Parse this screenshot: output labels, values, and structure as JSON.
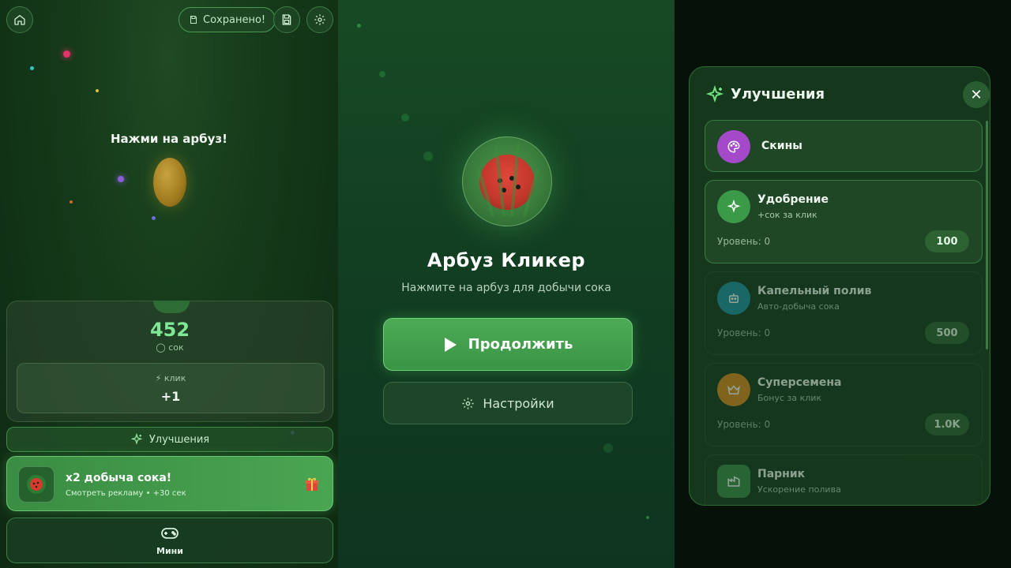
{
  "left_panel": {
    "saved_label": "Сохранено!",
    "tap_hint": "Нажми на арбуз!",
    "juice": {
      "value": "452",
      "unit": "сок"
    },
    "click": {
      "label": "клик",
      "value": "+1"
    },
    "upgrades_label": "Улучшения",
    "ad": {
      "title": "x2 добыча сока!",
      "subtitle": "Смотреть рекламу • +30 сек"
    },
    "mini_label": "Мини"
  },
  "main_menu": {
    "title": "Арбуз Кликер",
    "subtitle": "Нажмите на арбуз для добычи сока",
    "continue_label": "Продолжить",
    "settings_label": "Настройки"
  },
  "upgrades_modal": {
    "title": "Улучшения",
    "items": [
      {
        "name": "Скины",
        "icon": "palette-icon",
        "icon_color": "#a349c9"
      },
      {
        "name": "Удобрение",
        "desc": "+сок за клик",
        "level": "Уровень: 0",
        "price": "100",
        "icon": "sparkles-icon",
        "icon_color": "#3a9a47"
      },
      {
        "name": "Капельный полив",
        "desc": "Авто-добыча сока",
        "level": "Уровень: 0",
        "price": "500",
        "icon": "robot-icon",
        "icon_color": "#1e8fa3"
      },
      {
        "name": "Суперсемена",
        "desc": "Бонус за клик",
        "level": "Уровень: 0",
        "price": "1.0K",
        "icon": "crown-icon",
        "icon_color": "#d9891f"
      },
      {
        "name": "Парник",
        "desc": "Ускорение полива",
        "icon": "factory-icon",
        "icon_color": "#3a8a47"
      }
    ]
  },
  "colors": {
    "accent_green": "#4caa55",
    "juice_green": "#7fe896",
    "background": "#0a1a0e"
  }
}
